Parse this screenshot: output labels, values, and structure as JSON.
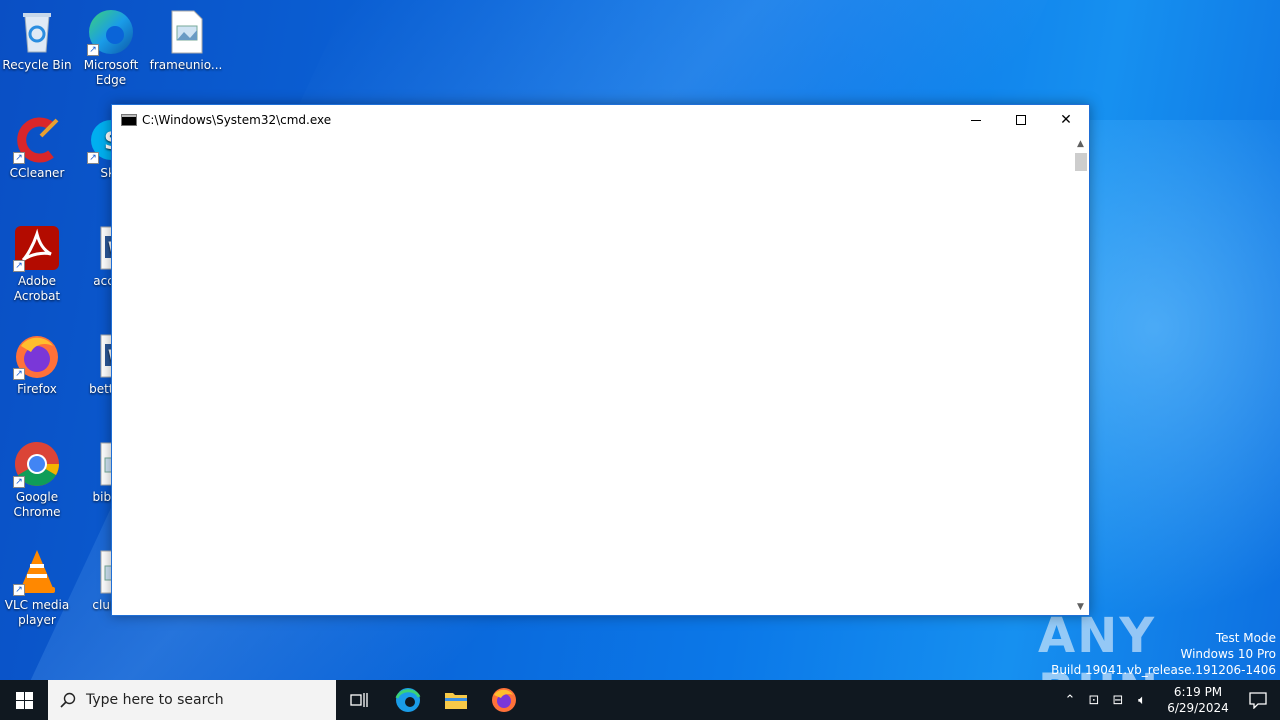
{
  "desktop": {
    "icons": [
      {
        "label": "Recycle Bin",
        "icon": "recycle-bin-icon"
      },
      {
        "label": "Microsoft Edge",
        "icon": "edge-icon"
      },
      {
        "label": "frameunio...",
        "icon": "image-file-icon"
      },
      {
        "label": "CCleaner",
        "icon": "ccleaner-icon"
      },
      {
        "label": "Sky",
        "icon": "skype-icon"
      },
      {
        "label": "Adobe Acrobat",
        "icon": "acrobat-icon"
      },
      {
        "label": "accou",
        "icon": "word-doc-icon"
      },
      {
        "label": "Firefox",
        "icon": "firefox-icon"
      },
      {
        "label": "bettero",
        "icon": "word-doc-icon"
      },
      {
        "label": "Google Chrome",
        "icon": "chrome-icon"
      },
      {
        "label": "bibleb",
        "icon": "image-file-icon"
      },
      {
        "label": "VLC media player",
        "icon": "vlc-icon"
      },
      {
        "label": "clubto",
        "icon": "image-file-icon"
      }
    ]
  },
  "window": {
    "title": "C:\\Windows\\System32\\cmd.exe",
    "minimize_glyph": "",
    "close_glyph": "✕"
  },
  "watermark": {
    "brand": "ANY RUN",
    "line1": "Test Mode",
    "line2": "Windows 10 Pro",
    "line3": "Build 19041.vb_release.191206-1406"
  },
  "taskbar": {
    "search_placeholder": "Type here to search",
    "time": "6:19 PM",
    "date": "6/29/2024"
  }
}
